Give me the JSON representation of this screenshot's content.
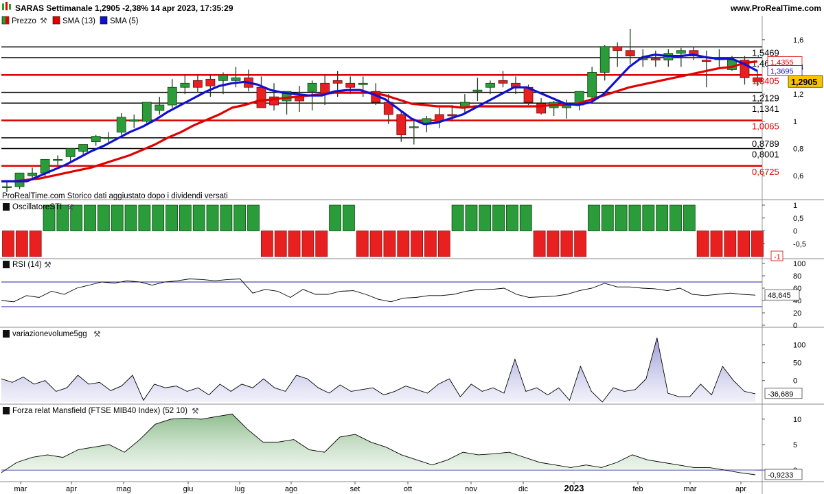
{
  "header": {
    "title": "SARAS Settimanale 1,2905 -2,38% 14 apr 2023, 17:35:29",
    "brand": "www.ProRealTime.com"
  },
  "price_panel": {
    "legend": [
      "Prezzo",
      "SMA (13)",
      "SMA (5)"
    ],
    "footer": "ProRealTime.com  Storico dati aggiustato dopo i dividendi versati",
    "y_ticks": [
      "1,6",
      "1,4",
      "1,2",
      "1",
      "0,8",
      "0,6"
    ],
    "levels_black": [
      {
        "value": 1.5469,
        "label": "1,5469"
      },
      {
        "value": 1.4681,
        "label": "1,4681"
      },
      {
        "value": 1.2129,
        "label": "1,2129"
      },
      {
        "value": 1.1341,
        "label": "1,1341"
      },
      {
        "value": 0.8789,
        "label": "0,8789"
      },
      {
        "value": 0.8001,
        "label": "0,8001"
      }
    ],
    "levels_red": [
      {
        "value": 1.3405,
        "label": "1,3405"
      },
      {
        "value": 1.0065,
        "label": "1,0065"
      },
      {
        "value": 0.6725,
        "label": "0,6725"
      }
    ],
    "badges": [
      {
        "value": 1.4355,
        "label": "1,4355",
        "color": "#e00000",
        "bold": false
      },
      {
        "value": 1.3695,
        "label": "1,3695",
        "color": "#1010d0",
        "bold": false
      },
      {
        "value": 1.2905,
        "label": "1,2905",
        "color": "#000000",
        "bold": true
      }
    ]
  },
  "sti_panel": {
    "label": "OscillatoreSTI",
    "y_ticks": [
      "1",
      "0,5",
      "0",
      "-0,5"
    ],
    "last_label": "-1"
  },
  "rsi_panel": {
    "label": "RSI (14)",
    "y_ticks": [
      "100",
      "80",
      "60",
      "40",
      "20",
      "0"
    ],
    "last_label": "48,645"
  },
  "vol_panel": {
    "label": "variazionevolume5gg",
    "y_ticks": [
      "100",
      "50",
      "0"
    ],
    "last_label": "-36,689"
  },
  "mans_panel": {
    "label": "Forza relat Mansfield (FTSE MIB40 Index) (52 10)",
    "y_ticks": [
      "10",
      "5",
      "0"
    ],
    "last_label": "-0,9233"
  },
  "chart_data": [
    {
      "type": "candlestick",
      "title": "SARAS Settimanale",
      "x_labels": [
        "mar",
        "apr",
        "mag",
        "giu",
        "lug",
        "ago",
        "set",
        "ott",
        "nov",
        "dic",
        "2023",
        "feb",
        "mar",
        "apr"
      ],
      "ylim": [
        0.5,
        1.7
      ],
      "series": [
        {
          "name": "Prezzo",
          "open": [
            0.52,
            0.52,
            0.6,
            0.62,
            0.72,
            0.74,
            0.78,
            0.85,
            0.88,
            0.92,
            1.0,
            1.0,
            1.08,
            1.12,
            1.25,
            1.3,
            1.31,
            1.3,
            1.3,
            1.32,
            1.25,
            1.18,
            1.15,
            1.18,
            1.22,
            1.28,
            1.3,
            1.28,
            1.27,
            1.22,
            1.14,
            1.05,
            0.96,
            0.98,
            1.05,
            1.05,
            1.1,
            1.22,
            1.25,
            1.3,
            1.28,
            1.25,
            1.13,
            1.1,
            1.1,
            1.12,
            1.18,
            1.36,
            1.55,
            1.52,
            1.46,
            1.46,
            1.45,
            1.5,
            1.52,
            1.45,
            1.46,
            1.38,
            1.45,
            1.32
          ],
          "high": [
            0.56,
            0.6,
            0.66,
            0.66,
            0.75,
            0.8,
            0.82,
            0.9,
            0.92,
            1.06,
            1.05,
            1.12,
            1.18,
            1.31,
            1.34,
            1.34,
            1.34,
            1.36,
            1.4,
            1.38,
            1.33,
            1.28,
            1.2,
            1.26,
            1.3,
            1.34,
            1.37,
            1.33,
            1.33,
            1.28,
            1.2,
            1.08,
            1.0,
            1.04,
            1.1,
            1.12,
            1.2,
            1.32,
            1.3,
            1.37,
            1.33,
            1.27,
            1.17,
            1.15,
            1.16,
            1.22,
            1.4,
            1.56,
            1.58,
            1.68,
            1.53,
            1.52,
            1.53,
            1.54,
            1.55,
            1.52,
            1.53,
            1.48,
            1.48,
            1.37
          ],
          "low": [
            0.48,
            0.5,
            0.58,
            0.58,
            0.68,
            0.71,
            0.76,
            0.82,
            0.84,
            0.9,
            0.95,
            0.97,
            1.05,
            1.1,
            1.2,
            1.21,
            1.18,
            1.2,
            1.25,
            1.22,
            1.1,
            1.08,
            1.05,
            1.07,
            1.08,
            1.12,
            1.18,
            1.2,
            1.18,
            1.12,
            0.98,
            0.85,
            0.83,
            0.92,
            0.95,
            1.0,
            1.05,
            1.15,
            1.2,
            1.25,
            1.2,
            1.12,
            1.05,
            1.04,
            1.02,
            1.08,
            1.15,
            1.3,
            1.4,
            1.42,
            1.4,
            1.4,
            1.4,
            1.4,
            1.45,
            1.25,
            1.4,
            1.37,
            1.27,
            1.26
          ],
          "close": [
            0.52,
            0.62,
            0.62,
            0.72,
            0.72,
            0.8,
            0.83,
            0.89,
            0.88,
            1.03,
            1.01,
            1.14,
            1.12,
            1.25,
            1.28,
            1.25,
            1.26,
            1.34,
            1.32,
            1.25,
            1.1,
            1.12,
            1.22,
            1.15,
            1.28,
            1.2,
            1.28,
            1.25,
            1.28,
            1.14,
            1.05,
            0.9,
            0.96,
            1.02,
            1.0,
            1.04,
            1.14,
            1.23,
            1.28,
            1.28,
            1.25,
            1.14,
            1.06,
            1.14,
            1.12,
            1.22,
            1.36,
            1.55,
            1.52,
            1.48,
            1.46,
            1.45,
            1.5,
            1.52,
            1.48,
            1.44,
            1.46,
            1.45,
            1.32,
            1.29
          ]
        },
        {
          "name": "SMA (13)",
          "values": [
            0.56,
            0.56,
            0.57,
            0.58,
            0.6,
            0.62,
            0.64,
            0.66,
            0.69,
            0.72,
            0.75,
            0.79,
            0.83,
            0.88,
            0.92,
            0.97,
            1.01,
            1.05,
            1.1,
            1.12,
            1.15,
            1.16,
            1.17,
            1.18,
            1.19,
            1.2,
            1.21,
            1.21,
            1.21,
            1.21,
            1.19,
            1.16,
            1.13,
            1.12,
            1.11,
            1.11,
            1.1,
            1.11,
            1.11,
            1.11,
            1.11,
            1.11,
            1.11,
            1.12,
            1.12,
            1.13,
            1.16,
            1.19,
            1.22,
            1.25,
            1.27,
            1.29,
            1.31,
            1.33,
            1.35,
            1.37,
            1.39,
            1.4,
            1.43,
            1.44
          ]
        },
        {
          "name": "SMA (5)",
          "values": [
            0.56,
            0.56,
            0.56,
            0.6,
            0.64,
            0.68,
            0.73,
            0.78,
            0.82,
            0.87,
            0.92,
            0.96,
            1.01,
            1.07,
            1.12,
            1.17,
            1.22,
            1.26,
            1.28,
            1.29,
            1.27,
            1.23,
            1.21,
            1.2,
            1.19,
            1.19,
            1.22,
            1.23,
            1.23,
            1.2,
            1.16,
            1.09,
            1.02,
            0.98,
            0.99,
            1.02,
            1.05,
            1.1,
            1.15,
            1.2,
            1.25,
            1.25,
            1.21,
            1.17,
            1.13,
            1.12,
            1.14,
            1.2,
            1.3,
            1.4,
            1.47,
            1.49,
            1.48,
            1.48,
            1.49,
            1.47,
            1.46,
            1.46,
            1.42,
            1.37
          ]
        }
      ]
    },
    {
      "type": "bar",
      "title": "OscillatoreSTI",
      "ylim": [
        -1,
        1
      ],
      "values": [
        -1,
        -1,
        -1,
        1,
        1,
        1,
        1,
        1,
        1,
        1,
        1,
        1,
        1,
        1,
        1,
        1,
        1,
        1,
        1,
        -1,
        -1,
        -1,
        -1,
        -1,
        1,
        1,
        -1,
        -1,
        -1,
        -1,
        -1,
        -1,
        -1,
        1,
        1,
        1,
        1,
        1,
        1,
        -1,
        -1,
        -1,
        -1,
        1,
        1,
        1,
        1,
        1,
        1,
        1,
        1,
        -1,
        -1,
        -1,
        -1,
        -1
      ]
    },
    {
      "type": "line",
      "title": "RSI (14)",
      "ylim": [
        0,
        100
      ],
      "reference_lines": [
        70,
        30
      ],
      "values": [
        40,
        38,
        48,
        45,
        55,
        50,
        60,
        65,
        70,
        68,
        72,
        70,
        65,
        70,
        72,
        75,
        74,
        72,
        74,
        75,
        52,
        58,
        55,
        45,
        58,
        50,
        50,
        55,
        56,
        50,
        42,
        38,
        44,
        45,
        48,
        48,
        50,
        55,
        58,
        58,
        60,
        50,
        45,
        46,
        47,
        50,
        56,
        60,
        68,
        62,
        62,
        60,
        59,
        56,
        60,
        50,
        48,
        50,
        52,
        50,
        48.645
      ]
    },
    {
      "type": "area",
      "title": "variazionevolume5gg",
      "ylim": [
        -60,
        130
      ],
      "values": [
        5,
        -5,
        10,
        -10,
        0,
        -30,
        -20,
        15,
        -10,
        -5,
        -28,
        -15,
        15,
        -55,
        -10,
        -20,
        -15,
        -30,
        -20,
        -40,
        -10,
        -30,
        -10,
        -20,
        5,
        -20,
        -30,
        15,
        5,
        -20,
        -35,
        -12,
        -30,
        -25,
        -20,
        -40,
        -30,
        -15,
        -25,
        -35,
        -10,
        5,
        -45,
        -10,
        -30,
        -20,
        -35,
        60,
        -30,
        -20,
        -40,
        -20,
        -55,
        40,
        -30,
        -60,
        -20,
        -30,
        -25,
        5,
        120,
        -35,
        -45,
        -45,
        -10,
        -40,
        40,
        0,
        -30,
        -36.689
      ]
    },
    {
      "type": "area",
      "title": "Forza relat Mansfield (FTSE MIB40 Index) (52 10)",
      "ylim": [
        -2,
        12
      ],
      "values": [
        -0.5,
        1.5,
        2.5,
        3,
        2.5,
        4,
        4.5,
        5,
        3.5,
        6,
        9,
        10,
        10.2,
        10,
        10.5,
        11,
        8,
        5.5,
        5.5,
        6,
        4,
        3.5,
        6.5,
        7,
        5.5,
        4.5,
        3,
        2,
        1,
        2,
        3.5,
        3,
        3.2,
        3.5,
        2.5,
        1.5,
        1,
        0.5,
        1,
        0.5,
        1.5,
        3,
        2,
        1.5,
        1,
        0.5,
        0.5,
        0,
        -0.5,
        -0.92
      ]
    }
  ]
}
